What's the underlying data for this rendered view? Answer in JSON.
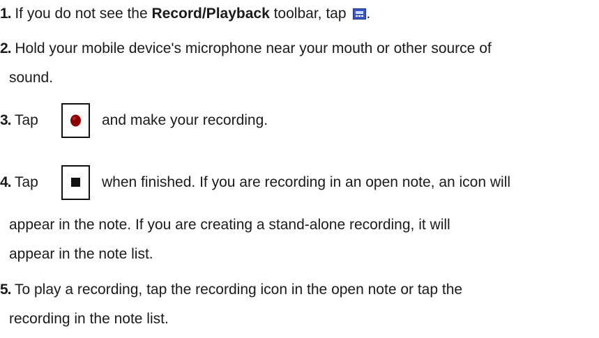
{
  "steps": [
    {
      "number": "1.",
      "text_before": " If you do not see the ",
      "bold": "Record/Playback",
      "text_after": " toolbar, tap ",
      "icon": "record-playback-toolbar-icon",
      "trailing": "."
    },
    {
      "number": "2.",
      "line1": " Hold your mobile device's microphone near your mouth or other source of",
      "line2": "sound."
    },
    {
      "number": "3.",
      "text_before": " Tap",
      "icon": "record-button-icon",
      "text_after": "and make your recording."
    },
    {
      "number": "4.",
      "text_before": " Tap",
      "icon": "stop-button-icon",
      "text_after": "when finished. If you are recording in an open note, an icon will",
      "line2": "appear in the note. If you are creating a stand-alone recording, it will",
      "line3": "appear in the note list."
    },
    {
      "number": "5.",
      "line1": " To play a recording, tap the recording icon in the open note or tap the",
      "line2": "recording in the note list."
    }
  ],
  "colors": {
    "text": "#1a1a1a",
    "record_dot": "#8b0000",
    "toolbar_icon_bg": "#3a56c8"
  }
}
